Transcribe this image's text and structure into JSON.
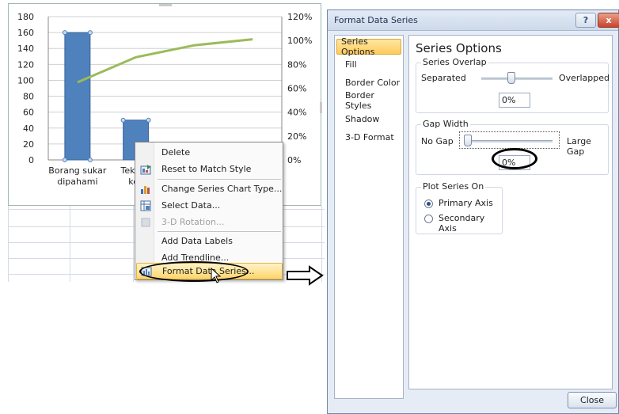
{
  "chart_data": {
    "type": "bar",
    "categories": [
      "Borang sukar\ndipahami",
      "Teks te\nkec",
      "",
      ""
    ],
    "values": [
      160,
      50,
      0,
      0
    ],
    "line_series": {
      "axis": "secondary",
      "values": [
        65,
        86,
        96,
        101
      ],
      "color": "#9bbb59"
    },
    "bar_color": "#4f81bd",
    "y_ticks": [
      "180",
      "160",
      "140",
      "120",
      "100",
      "80",
      "60",
      "40",
      "20",
      "0"
    ],
    "y2_ticks": [
      "120%",
      "100%",
      "80%",
      "60%",
      "40%",
      "20%",
      "0%"
    ],
    "ylim": [
      0,
      180
    ],
    "y2lim": [
      0,
      120
    ],
    "grid": true
  },
  "context_menu": {
    "items": [
      {
        "label": "Delete",
        "icon": "",
        "disabled": false
      },
      {
        "label": "Reset to Match Style",
        "icon": "reset-style-icon",
        "disabled": false
      },
      {
        "label": "Change Series Chart Type...",
        "icon": "chart-type-icon",
        "disabled": false
      },
      {
        "label": "Select Data...",
        "icon": "select-data-icon",
        "disabled": false
      },
      {
        "label": "3-D Rotation...",
        "icon": "3d-rotation-icon",
        "disabled": true
      },
      {
        "label": "Add Data Labels",
        "icon": "",
        "disabled": false
      },
      {
        "label": "Add Trendline...",
        "icon": "",
        "disabled": false
      },
      {
        "label": "Format Data Series...",
        "icon": "format-series-icon",
        "disabled": false
      }
    ]
  },
  "dialog": {
    "title": "Format Data Series",
    "help_label": "?",
    "close_x_label": "x",
    "nav": [
      "Series Options",
      "Fill",
      "Border Color",
      "Border Styles",
      "Shadow",
      "3-D Format"
    ],
    "panel_title": "Series Options",
    "overlap": {
      "legend": "Series Overlap",
      "left": "Separated",
      "right": "Overlapped",
      "value": "0%",
      "level": 0.5
    },
    "gap": {
      "legend": "Gap Width",
      "left": "No Gap",
      "right": "Large Gap",
      "value": "0%",
      "level": 0.0
    },
    "plot_on": {
      "legend": "Plot Series On",
      "options": [
        "Primary Axis",
        "Secondary Axis"
      ],
      "selected": 0
    },
    "close_button": "Close"
  }
}
